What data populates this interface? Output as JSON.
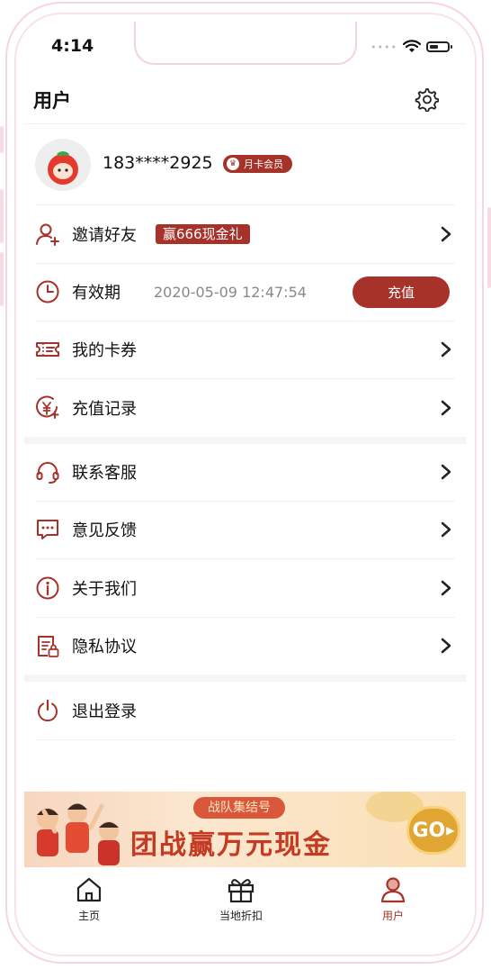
{
  "status_bar": {
    "time": "4:14"
  },
  "header": {
    "title": "用户",
    "settings_icon": "gear-icon"
  },
  "profile": {
    "phone": "183****2925",
    "membership_badge": "月卡会员"
  },
  "menu_section_1": [
    {
      "id": "invite",
      "label": "邀请好友",
      "badge": "赢666现金礼",
      "icon": "user-add-icon"
    },
    {
      "id": "validity",
      "label": "有效期",
      "value": "2020-05-09 12:47:54",
      "button": "充值",
      "icon": "clock-icon"
    },
    {
      "id": "coupons",
      "label": "我的卡券",
      "icon": "ticket-icon"
    },
    {
      "id": "recharge-records",
      "label": "充值记录",
      "icon": "yen-record-icon"
    }
  ],
  "menu_section_2": [
    {
      "id": "support",
      "label": "联系客服",
      "icon": "headset-icon"
    },
    {
      "id": "feedback",
      "label": "意见反馈",
      "icon": "message-icon"
    },
    {
      "id": "about",
      "label": "关于我们",
      "icon": "info-icon"
    },
    {
      "id": "privacy",
      "label": "隐私协议",
      "icon": "document-lock-icon"
    }
  ],
  "logout": {
    "label": "退出登录",
    "icon": "power-icon"
  },
  "banner": {
    "tag": "战队集结号",
    "headline": "团战赢万元现金",
    "go_label": "GO"
  },
  "tabbar": [
    {
      "id": "home",
      "label": "主页",
      "icon": "home-icon",
      "active": false
    },
    {
      "id": "local-deals",
      "label": "当地折扣",
      "icon": "gift-icon",
      "active": false
    },
    {
      "id": "user",
      "label": "用户",
      "icon": "user-icon",
      "active": true
    }
  ],
  "colors": {
    "accent": "#a6322a",
    "divider": "#f0f0f0"
  }
}
